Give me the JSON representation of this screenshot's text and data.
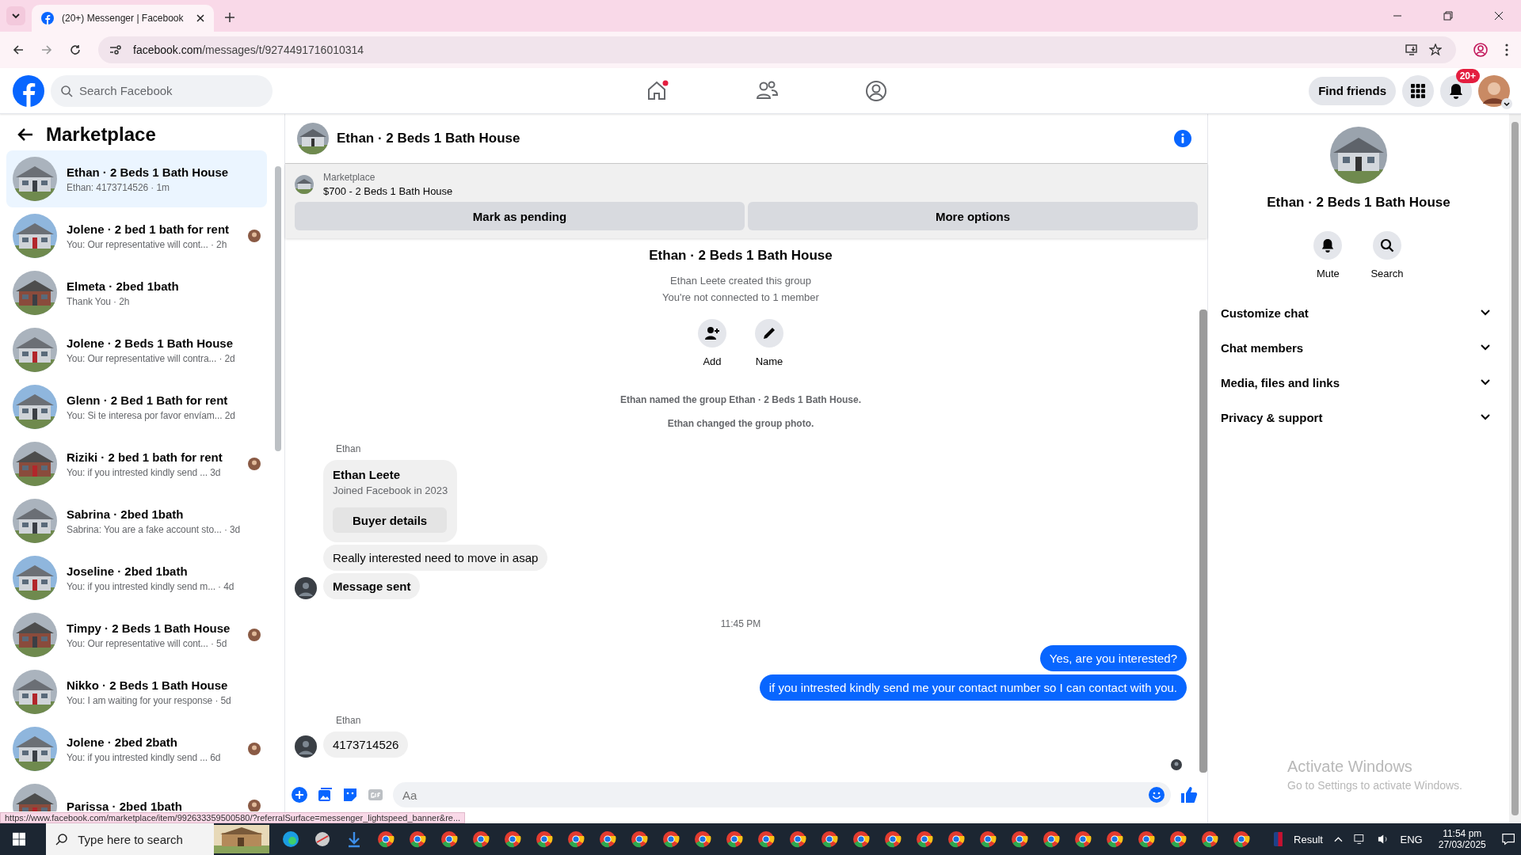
{
  "browser": {
    "tab_title": "(20+) Messenger | Facebook",
    "url_host": "facebook.com",
    "url_path": "/messages/t/9274491716010314",
    "status_url": "https://www.facebook.com/marketplace/item/992633359500580/?referralSurface=messenger_lightspeed_banner&re..."
  },
  "header": {
    "search_placeholder": "Search Facebook",
    "find_friends": "Find friends",
    "notification_badge": "20+"
  },
  "sidebar": {
    "title": "Marketplace",
    "threads": [
      {
        "title": "Ethan · 2 Beds 1 Bath House",
        "preview": "Ethan: 4173714526 · 1m",
        "selected": true,
        "seen_avatar": false
      },
      {
        "title": "Jolene · 2 bed 1 bath for rent",
        "preview": "You: Our representative will cont... · 2h",
        "selected": false,
        "seen_avatar": true
      },
      {
        "title": "Elmeta · 2bed 1bath",
        "preview": "Thank You · 2h",
        "selected": false,
        "seen_avatar": false
      },
      {
        "title": "Jolene · 2 Beds 1 Bath House",
        "preview": "You: Our representative will contra... · 2d",
        "selected": false,
        "seen_avatar": false
      },
      {
        "title": "Glenn · 2 Bed 1 Bath for rent",
        "preview": "You: Si te interesa por favor envíam... 2d",
        "selected": false,
        "seen_avatar": false
      },
      {
        "title": "Riziki · 2 bed 1 bath for rent",
        "preview": "You: if you intrested kindly send ... 3d",
        "selected": false,
        "seen_avatar": true
      },
      {
        "title": "Sabrina · 2bed 1bath",
        "preview": "Sabrina: You are a fake account sto... · 3d",
        "selected": false,
        "seen_avatar": false
      },
      {
        "title": "Joseline · 2bed 1bath",
        "preview": "You: if you intrested kindly send m... · 4d",
        "selected": false,
        "seen_avatar": false
      },
      {
        "title": "Timpy · 2 Beds 1 Bath House",
        "preview": "You: Our representative will cont... · 5d",
        "selected": false,
        "seen_avatar": true
      },
      {
        "title": "Nikko · 2 Beds 1 Bath House",
        "preview": "You: I am waiting for your response · 5d",
        "selected": false,
        "seen_avatar": false
      },
      {
        "title": "Jolene · 2bed 2bath",
        "preview": "You: if you intrested kindly send ... 6d",
        "selected": false,
        "seen_avatar": true
      },
      {
        "title": "Parissa · 2bed 1bath",
        "selected": false,
        "seen_avatar": true
      }
    ]
  },
  "chat": {
    "title": "Ethan · 2 Beds 1 Bath House",
    "listing": {
      "label": "Marketplace",
      "item": "$700 - 2 Beds 1 Bath House",
      "buttons": [
        "Mark as pending",
        "More options"
      ]
    },
    "intro": {
      "title": "Ethan · 2 Beds 1 Bath House",
      "lines": [
        "Ethan Leete created this group",
        "You're not connected to 1 member"
      ],
      "actions": [
        {
          "kind": "add",
          "label": "Add"
        },
        {
          "kind": "name",
          "label": "Name"
        }
      ]
    },
    "messages": [
      {
        "kind": "notice",
        "text": "Ethan named the group Ethan · 2 Beds 1 Bath House."
      },
      {
        "kind": "notice",
        "text": "Ethan changed the group photo."
      },
      {
        "kind": "sender",
        "text": "Ethan"
      },
      {
        "kind": "card",
        "name": "Ethan Leete",
        "subtitle": "Joined Facebook in 2023",
        "button": "Buyer details"
      },
      {
        "kind": "in",
        "text": "Really interested need to move in asap",
        "avatar": false,
        "strong": false
      },
      {
        "kind": "in",
        "text": "Message sent",
        "avatar": true,
        "strong": true
      },
      {
        "kind": "time",
        "text": "11:45 PM"
      },
      {
        "kind": "out",
        "text": "Yes, are you interested?"
      },
      {
        "kind": "out",
        "text": "if you intrested kindly send me your contact number so I can contact with you."
      },
      {
        "kind": "sender",
        "text": "Ethan"
      },
      {
        "kind": "in",
        "text": "4173714526",
        "avatar": true,
        "strong": false
      }
    ],
    "composer_placeholder": "Aa"
  },
  "details": {
    "title": "Ethan · 2 Beds 1 Bath House",
    "actions": [
      {
        "kind": "mute",
        "label": "Mute"
      },
      {
        "kind": "search",
        "label": "Search"
      }
    ],
    "sections": [
      "Customize chat",
      "Chat members",
      "Media, files and links",
      "Privacy & support"
    ]
  },
  "activation": {
    "title": "Activate Windows",
    "subtitle": "Go to Settings to activate Windows."
  },
  "taskbar": {
    "search_placeholder": "Type here to search",
    "widget": "Result",
    "lang": "ENG",
    "time": "11:54 pm",
    "date": "27/03/2025"
  }
}
